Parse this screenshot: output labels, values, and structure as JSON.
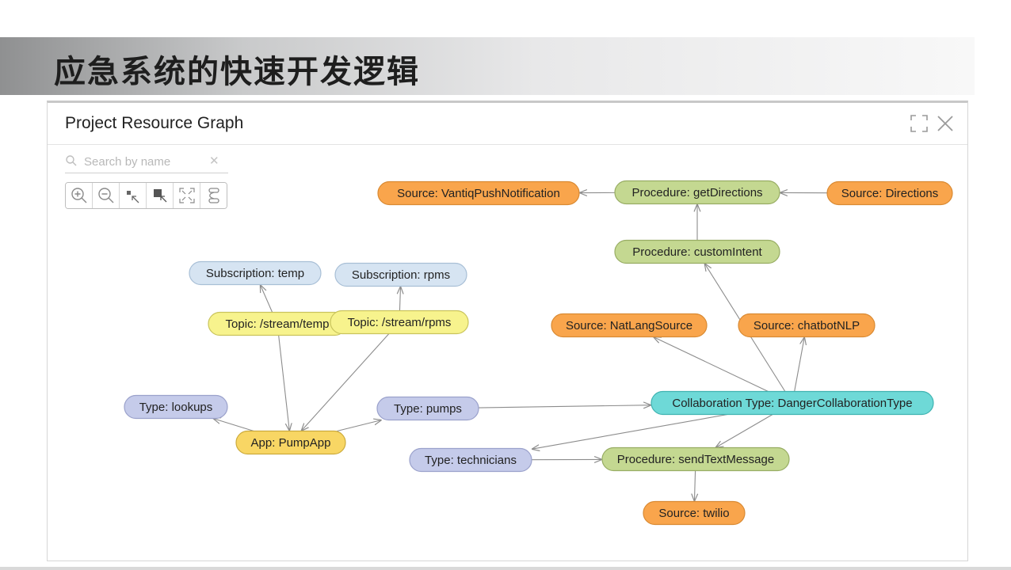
{
  "slide": {
    "title": "应急系统的快速开发逻辑"
  },
  "panel": {
    "title": "Project Resource Graph",
    "search": {
      "placeholder": "Search by name",
      "value": ""
    },
    "header_icons": [
      "expand-icon",
      "close-icon"
    ],
    "toolbar": [
      "zoom-in-icon",
      "zoom-out-icon",
      "select-upstream-icon",
      "select-downstream-icon",
      "fit-view-icon",
      "layout-icon"
    ]
  },
  "colors": {
    "source": {
      "fill": "#f9a54c",
      "stroke": "#d98a33"
    },
    "procedure": {
      "fill": "#c4d891",
      "stroke": "#98ad64"
    },
    "subscription": {
      "fill": "#d6e4f2",
      "stroke": "#a8bfd6"
    },
    "topic": {
      "fill": "#f7f38d",
      "stroke": "#c9c45c"
    },
    "type": {
      "fill": "#c5cbea",
      "stroke": "#9aa1cb"
    },
    "app": {
      "fill": "#f8d664",
      "stroke": "#ccab3c"
    },
    "collaboration": {
      "fill": "#6ed9d7",
      "stroke": "#3fb3b1"
    }
  },
  "graph": {
    "nodes": [
      {
        "id": "vantiq",
        "label": "Source: VantiqPushNotification",
        "kind": "source"
      },
      {
        "id": "getdir",
        "label": "Procedure: getDirections",
        "kind": "procedure"
      },
      {
        "id": "directions",
        "label": "Source: Directions",
        "kind": "source"
      },
      {
        "id": "custom",
        "label": "Procedure: customIntent",
        "kind": "procedure"
      },
      {
        "id": "subtemp",
        "label": "Subscription: temp",
        "kind": "subscription"
      },
      {
        "id": "subrpms",
        "label": "Subscription: rpms",
        "kind": "subscription"
      },
      {
        "id": "toptemp",
        "label": "Topic: /stream/temp",
        "kind": "topic"
      },
      {
        "id": "toprpms",
        "label": "Topic: /stream/rpms",
        "kind": "topic"
      },
      {
        "id": "natlang",
        "label": "Source: NatLangSource",
        "kind": "source"
      },
      {
        "id": "chatbot",
        "label": "Source: chatbotNLP",
        "kind": "source"
      },
      {
        "id": "lookups",
        "label": "Type: lookups",
        "kind": "type"
      },
      {
        "id": "pumps",
        "label": "Type: pumps",
        "kind": "type"
      },
      {
        "id": "collab",
        "label": "Collaboration Type: DangerCollaborationType",
        "kind": "collaboration"
      },
      {
        "id": "pumpapp",
        "label": "App: PumpApp",
        "kind": "app"
      },
      {
        "id": "techs",
        "label": "Type: technicians",
        "kind": "type"
      },
      {
        "id": "sendtext",
        "label": "Procedure: sendTextMessage",
        "kind": "procedure"
      },
      {
        "id": "twilio",
        "label": "Source: twilio",
        "kind": "source"
      }
    ],
    "edges": [
      {
        "from": "getdir",
        "to": "vantiq"
      },
      {
        "from": "directions",
        "to": "getdir"
      },
      {
        "from": "custom",
        "to": "getdir"
      },
      {
        "from": "collab",
        "to": "custom"
      },
      {
        "from": "collab",
        "to": "natlang"
      },
      {
        "from": "collab",
        "to": "chatbot"
      },
      {
        "from": "collab",
        "to": "sendtext"
      },
      {
        "from": "collab",
        "to": "techs"
      },
      {
        "from": "pumps",
        "to": "collab"
      },
      {
        "from": "pumpapp",
        "to": "pumps"
      },
      {
        "from": "pumpapp",
        "to": "lookups"
      },
      {
        "from": "toptemp",
        "to": "subtemp"
      },
      {
        "from": "toprpms",
        "to": "subrpms"
      },
      {
        "from": "toptemp",
        "to": "pumpapp"
      },
      {
        "from": "toprpms",
        "to": "pumpapp"
      },
      {
        "from": "techs",
        "to": "sendtext"
      },
      {
        "from": "sendtext",
        "to": "twilio"
      }
    ]
  }
}
